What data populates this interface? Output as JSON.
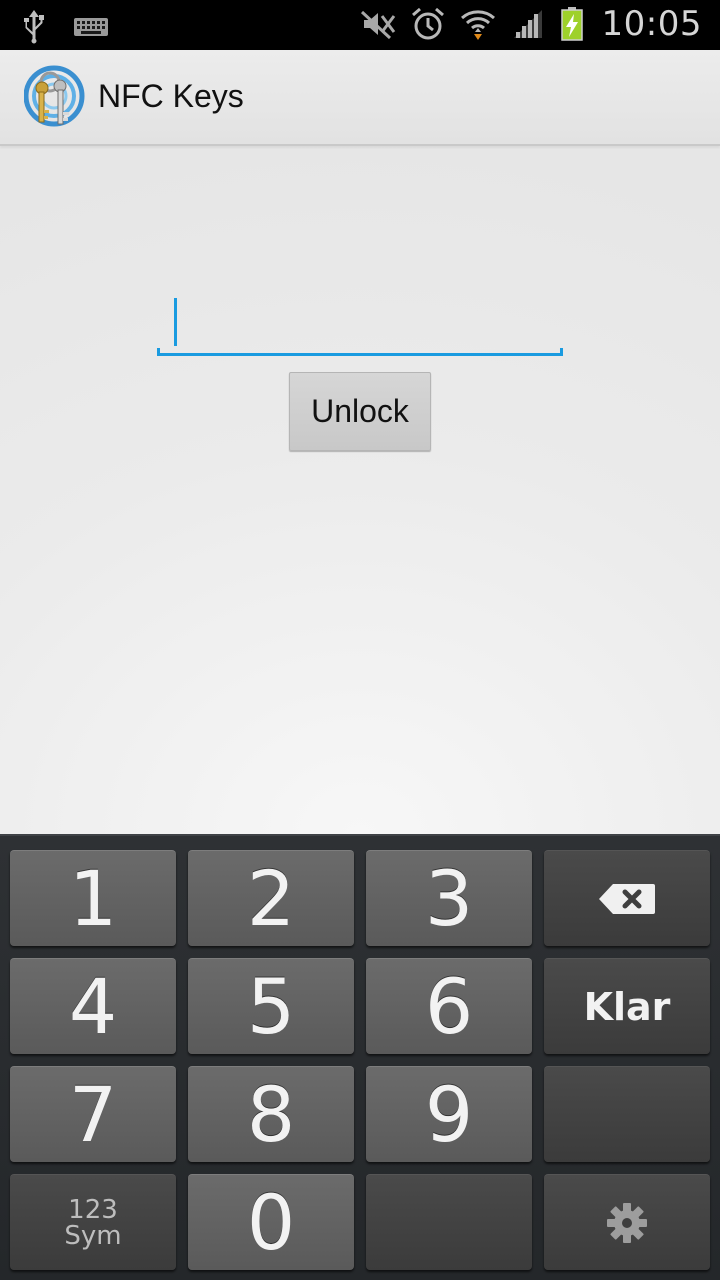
{
  "status_bar": {
    "time": "10:05",
    "icons": [
      "usb-icon",
      "keyboard-icon",
      "mute-icon",
      "alarm-icon",
      "wifi-icon",
      "signal-icon",
      "battery-charging-icon"
    ]
  },
  "app": {
    "title": "NFC Keys",
    "icon": "keys-nfc-icon"
  },
  "pin_input": {
    "value": "",
    "accent": "#1a9be0"
  },
  "unlock_button": {
    "label": "Unlock"
  },
  "keyboard": {
    "keys": {
      "k1": "1",
      "k2": "2",
      "k3": "3",
      "k4": "4",
      "k5": "5",
      "k6": "6",
      "k7": "7",
      "k8": "8",
      "k9": "9",
      "k0": "0",
      "done": "Klar",
      "sym_top": "123",
      "sym_bottom": "Sym"
    },
    "icons": [
      "backspace-icon",
      "settings-icon"
    ]
  }
}
